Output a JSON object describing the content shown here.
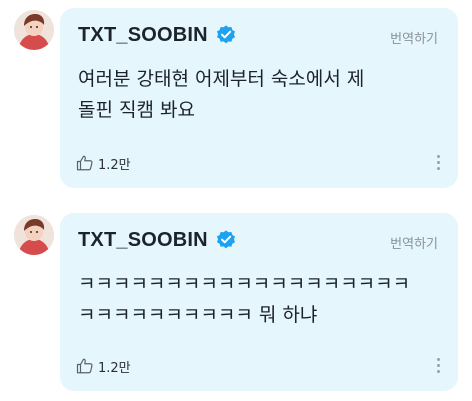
{
  "colors": {
    "bubble_bg": "#e6f6fd",
    "verified_badge": "#1da1f2",
    "secondary_text": "#8a9199"
  },
  "posts": [
    {
      "author": "TXT_SOOBIN",
      "verified_icon": "verified-badge-icon",
      "translate_label": "번역하기",
      "text": "여러분 강태현 어제부터 숙소에서 제\n돌핀 직캠 봐요",
      "like_icon": "thumbs-up-icon",
      "like_count": "1.2만",
      "more_icon": "more-vertical-icon"
    },
    {
      "author": "TXT_SOOBIN",
      "verified_icon": "verified-badge-icon",
      "translate_label": "번역하기",
      "text": "ㅋㅋㅋㅋㅋㅋㅋㅋㅋㅋㅋㅋㅋㅋㅋㅋㅋㅋㅋ\nㅋㅋㅋㅋㅋㅋㅋㅋㅋㅋ 뭐 하냐",
      "like_icon": "thumbs-up-icon",
      "like_count": "1.2만",
      "more_icon": "more-vertical-icon"
    }
  ]
}
